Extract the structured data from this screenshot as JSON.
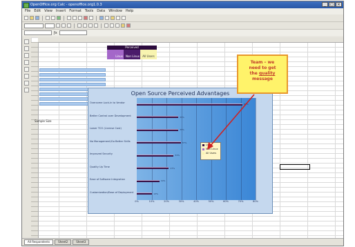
{
  "window": {
    "title": "OpenOffice.org Calc - openoffice.org1.0.3"
  },
  "menu": [
    "File",
    "Edit",
    "View",
    "Insert",
    "Format",
    "Tools",
    "Data",
    "Window",
    "Help"
  ],
  "spreadsheet": {
    "header_title": "Perceived",
    "col_headers": [
      "Linux",
      "Non Linux",
      "All Users"
    ],
    "label_cell": "Sample Size",
    "sheet_tabs": [
      "All Respondents",
      "Sheet2",
      "Sheet3"
    ]
  },
  "callout": {
    "line1": "Team – we",
    "line2": "need to get",
    "line3_pre": "the ",
    "line3_em": "quality",
    "line4": "message"
  },
  "chart_data": {
    "type": "bar",
    "title": "Open Source Perceived Advantages",
    "categories": [
      "Overcome Lock-in to Vendor",
      "Better Control over Development",
      "Lower TCO (License Cost)",
      "No Management/Go Better Skills",
      "Improved Security",
      "Quality Up Time",
      "Ease of Software Integration",
      "Customization/Ease of Deployment"
    ],
    "series": [
      {
        "name": "Linux",
        "values": [
          89,
          35,
          35,
          37,
          31,
          27,
          19,
          13
        ]
      }
    ],
    "data_labels": [
      "89%",
      "35%",
      "35%",
      "37%",
      "31%",
      "27%",
      "19%",
      "13%"
    ],
    "xlim": [
      0,
      100
    ],
    "xticks": [
      "0%",
      "10%",
      "20%",
      "30%",
      "40%",
      "50%",
      "60%",
      "70%",
      "80%"
    ],
    "legend_entries": [
      "Linux",
      "Non Linux",
      "All Users"
    ],
    "colors": {
      "bar": "#3a1247",
      "plot_start": "#7db3e6",
      "plot_end": "#3a86d6"
    }
  }
}
